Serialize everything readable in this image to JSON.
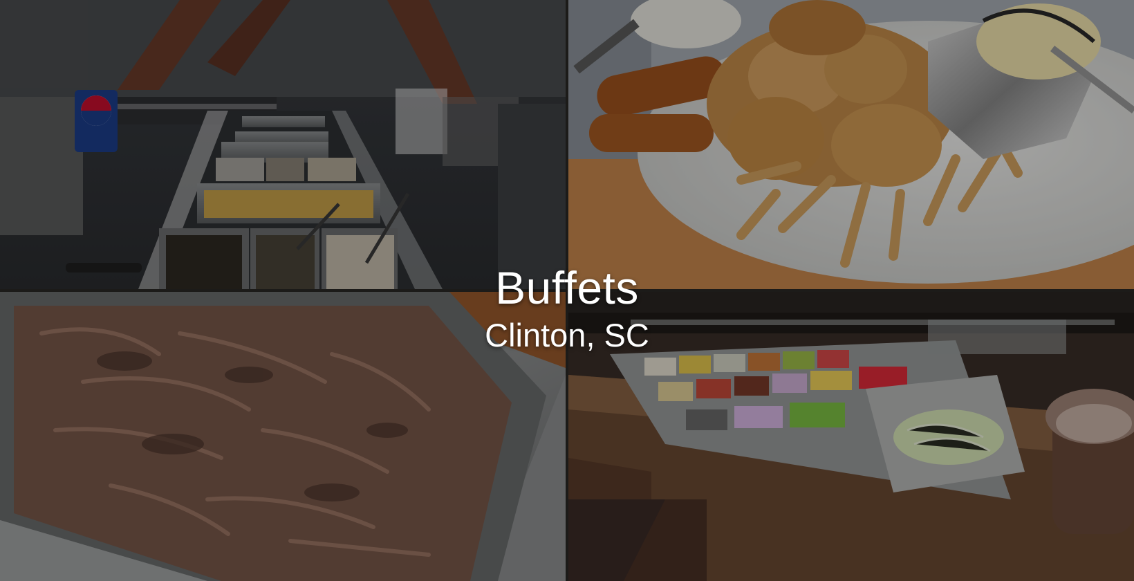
{
  "hero": {
    "title": "Buffets",
    "subtitle": "Clinton, SC"
  },
  "photos": [
    {
      "name": "buffet-line-photo",
      "description_icon": "steam-table-photo"
    },
    {
      "name": "fried-seafood-plate-photo",
      "description_icon": "seafood-platter-photo"
    },
    {
      "name": "pulled-pork-pan-photo",
      "description_icon": "pulled-pork-photo"
    },
    {
      "name": "salad-bar-photo",
      "description_icon": "salad-bar-photo"
    }
  ],
  "colors": {
    "overlay": "#000000",
    "text": "#ffffff",
    "steel": "#8d8f8f",
    "fried_food": "#b9874a",
    "pork": "#7a5a4c",
    "wood": "#6b4a33"
  }
}
